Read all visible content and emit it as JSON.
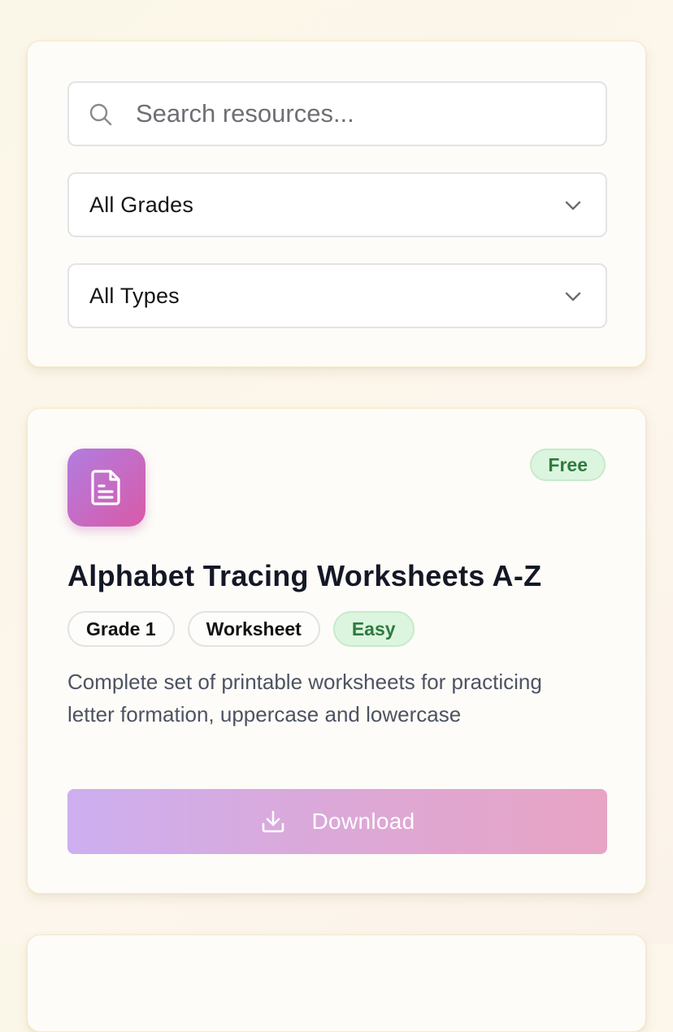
{
  "filters": {
    "search_placeholder": "Search resources...",
    "grade_select": {
      "value": "All Grades",
      "icon": "chevron-down-icon"
    },
    "type_select": {
      "value": "All Types",
      "icon": "chevron-down-icon"
    }
  },
  "resource": {
    "icon": "document-icon",
    "price_badge": "Free",
    "title": "Alphabet Tracing Worksheets A-Z",
    "tags": [
      {
        "label": "Grade 1"
      },
      {
        "label": "Worksheet"
      },
      {
        "label": "Easy"
      }
    ],
    "description": "Complete set of printable worksheets for practicing letter formation, uppercase and lowercase",
    "download_label": "Download",
    "download_icon": "download-icon"
  },
  "colors": {
    "accent_gradient_start": "#cdaff0",
    "accent_gradient_end": "#e8a4c4",
    "badge_gradient_start": "#b17de0",
    "badge_gradient_end": "#d95aa8",
    "success_bg": "#dcf5df",
    "success_text": "#2f7a3e"
  }
}
